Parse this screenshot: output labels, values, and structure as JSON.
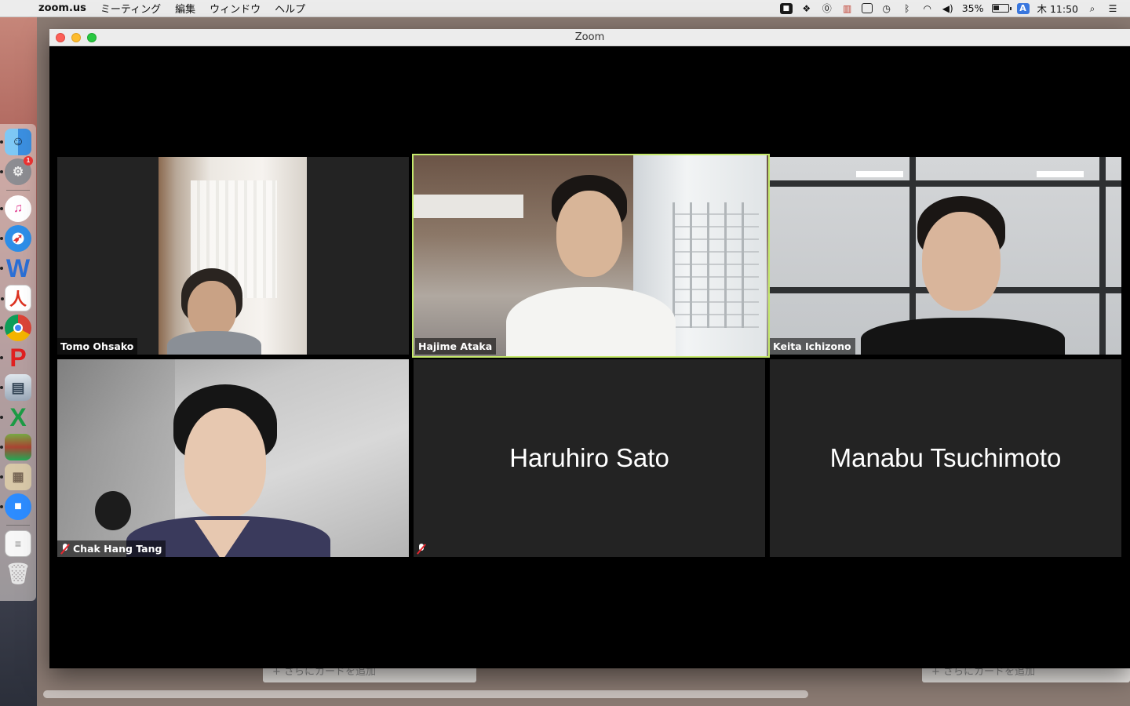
{
  "menubar": {
    "app_name": "zoom.us",
    "menus": [
      "ミーティング",
      "編集",
      "ウィンドウ",
      "ヘルプ"
    ],
    "battery": "35%",
    "clock": "木 11:50",
    "input_method": "A",
    "icons": [
      "zoom-camera-icon",
      "dropbox-icon",
      "onepassword-icon",
      "istat-icon",
      "screen-icon",
      "time-machine-icon",
      "bluetooth-icon",
      "wifi-icon",
      "volume-icon",
      "battery-icon",
      "spotlight-icon",
      "notification-center-icon"
    ]
  },
  "dock": {
    "apps": [
      "finder",
      "system-preferences",
      "itunes",
      "safari",
      "word",
      "acrobat",
      "chrome",
      "paw",
      "preview",
      "excel",
      "photo-app",
      "archive-utility",
      "zoom",
      "text-document",
      "trash"
    ],
    "badge": "1"
  },
  "window": {
    "title": "Zoom"
  },
  "participants": [
    {
      "name": "Tomo Ohsako",
      "video": true,
      "muted": false,
      "active": false
    },
    {
      "name": "Hajime Ataka",
      "video": true,
      "muted": false,
      "active": true
    },
    {
      "name": "Keita Ichizono",
      "video": true,
      "muted": false,
      "active": false
    },
    {
      "name": "Chak Hang Tang",
      "video": true,
      "muted": true,
      "active": false
    },
    {
      "name": "Haruhiro Sato",
      "video": false,
      "muted": true,
      "active": false
    },
    {
      "name": "Manabu Tsuchimoto",
      "video": false,
      "muted": false,
      "active": false
    }
  ],
  "background_app": {
    "add_card_label": "+ さらにカードを追加"
  },
  "colors": {
    "active_speaker_border": "#c4e86b",
    "tile_background": "#232323",
    "window_background": "#000000",
    "mute_red": "#e8262e"
  }
}
